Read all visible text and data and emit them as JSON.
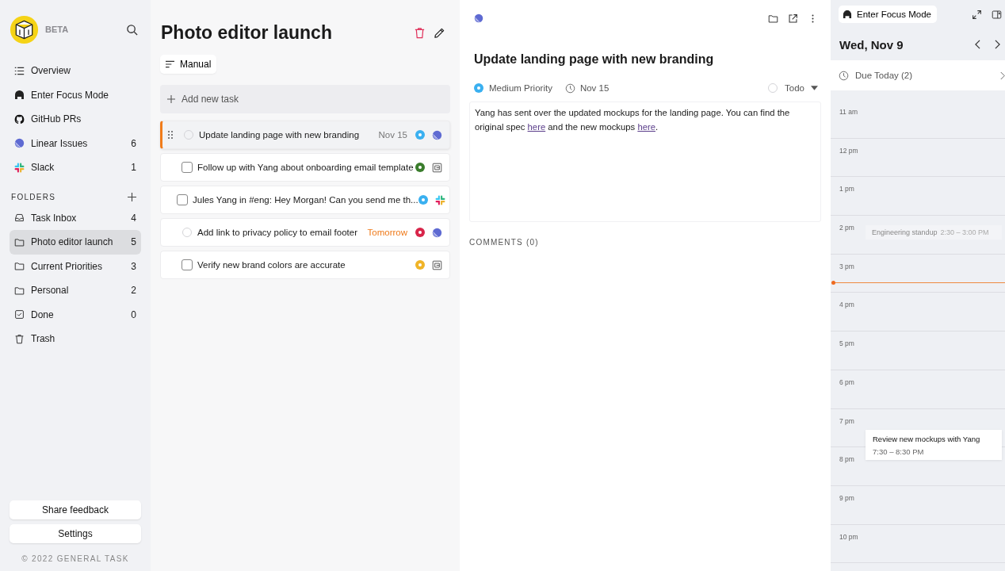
{
  "sidebar": {
    "beta_label": "BETA",
    "nav_items": [
      {
        "kind": "list",
        "label": "Overview",
        "selected": false
      },
      {
        "kind": "headphones",
        "label": "Enter Focus Mode",
        "selected": false
      },
      {
        "kind": "github",
        "label": "GitHub PRs",
        "selected": false
      },
      {
        "kind": "linear",
        "label": "Linear Issues",
        "count": "6",
        "selected": false
      },
      {
        "kind": "slack",
        "label": "Slack",
        "count": "1",
        "selected": false
      }
    ],
    "folders_heading": "FOLDERS",
    "folders": [
      {
        "kind": "inbox",
        "label": "Task Inbox",
        "count": "4",
        "selected": false
      },
      {
        "kind": "folder",
        "label": "Photo editor launch",
        "count": "5",
        "selected": true
      },
      {
        "kind": "folder",
        "label": "Current Priorities",
        "count": "3",
        "selected": false
      },
      {
        "kind": "folder",
        "label": "Personal",
        "count": "2",
        "selected": false
      },
      {
        "kind": "done",
        "label": "Done",
        "count": "0",
        "selected": false
      },
      {
        "kind": "trash",
        "label": "Trash",
        "selected": false
      }
    ],
    "buttons": [
      "Share feedback",
      "Settings"
    ],
    "copyright": "© 2022 GENERAL TASK"
  },
  "task_list": {
    "title": "Photo editor launch",
    "sort_label": "Manual",
    "add_placeholder": "Add new task",
    "tasks": [
      {
        "kind": "linear",
        "title": "Update landing page with new branding",
        "due": "Nov 15",
        "due_soon": false,
        "priority": {
          "color": "#3ab0f0"
        },
        "selected": true
      },
      {
        "kind": "document",
        "title": "Follow up with Yang about onboarding email template",
        "priority": {
          "color": "#3a7d2c"
        },
        "selected": false
      },
      {
        "kind": "slack",
        "title": "Jules Yang in #eng: Hey Morgan! Can you send me th...",
        "priority": {
          "color": "#3ab0f0"
        },
        "selected": false
      },
      {
        "kind": "linear",
        "title": "Add link to privacy policy to email footer",
        "due": "Tomorrow",
        "due_soon": true,
        "priority": {
          "color": "#d8254a"
        },
        "selected": false
      },
      {
        "kind": "document",
        "title": "Verify new brand colors are accurate",
        "priority": {
          "color": "#f0b428"
        },
        "selected": false
      }
    ]
  },
  "detail": {
    "kind": "linear",
    "title": "Update landing page with new branding",
    "priority": {
      "label": "Medium Priority",
      "color": "#3ab0f0"
    },
    "due": "Nov 15",
    "status": "Todo",
    "body": [
      {
        "text": "Yang has sent over the updated mockups for the landing page. You can find the original spec "
      },
      {
        "text": "here",
        "link": true
      },
      {
        "text": " and the new mockups "
      },
      {
        "text": "here",
        "link": true
      },
      {
        "text": "."
      }
    ],
    "comments_label": "COMMENTS (0)"
  },
  "calendar": {
    "focus_button": "Enter Focus Mode",
    "date": "Wed, Nov 9",
    "due_today": "Due Today (2)",
    "hours": [
      {
        "label": "11 am"
      },
      {
        "label": "12 pm"
      },
      {
        "label": "1 pm"
      },
      {
        "label": "2 pm",
        "events": [
          {
            "title": "Engineering standup",
            "time": "2:30 – 3:00 PM",
            "past": true
          }
        ]
      },
      {
        "label": "3 pm",
        "now": true
      },
      {
        "label": "4 pm"
      },
      {
        "label": "5 pm"
      },
      {
        "label": "6 pm"
      },
      {
        "label": "7 pm",
        "events": [
          {
            "title": "Review new mockups with Yang",
            "time": "7:30 – 8:30 PM",
            "past": false
          }
        ]
      },
      {
        "label": "8 pm"
      },
      {
        "label": "9 pm"
      },
      {
        "label": "10 pm"
      }
    ]
  }
}
